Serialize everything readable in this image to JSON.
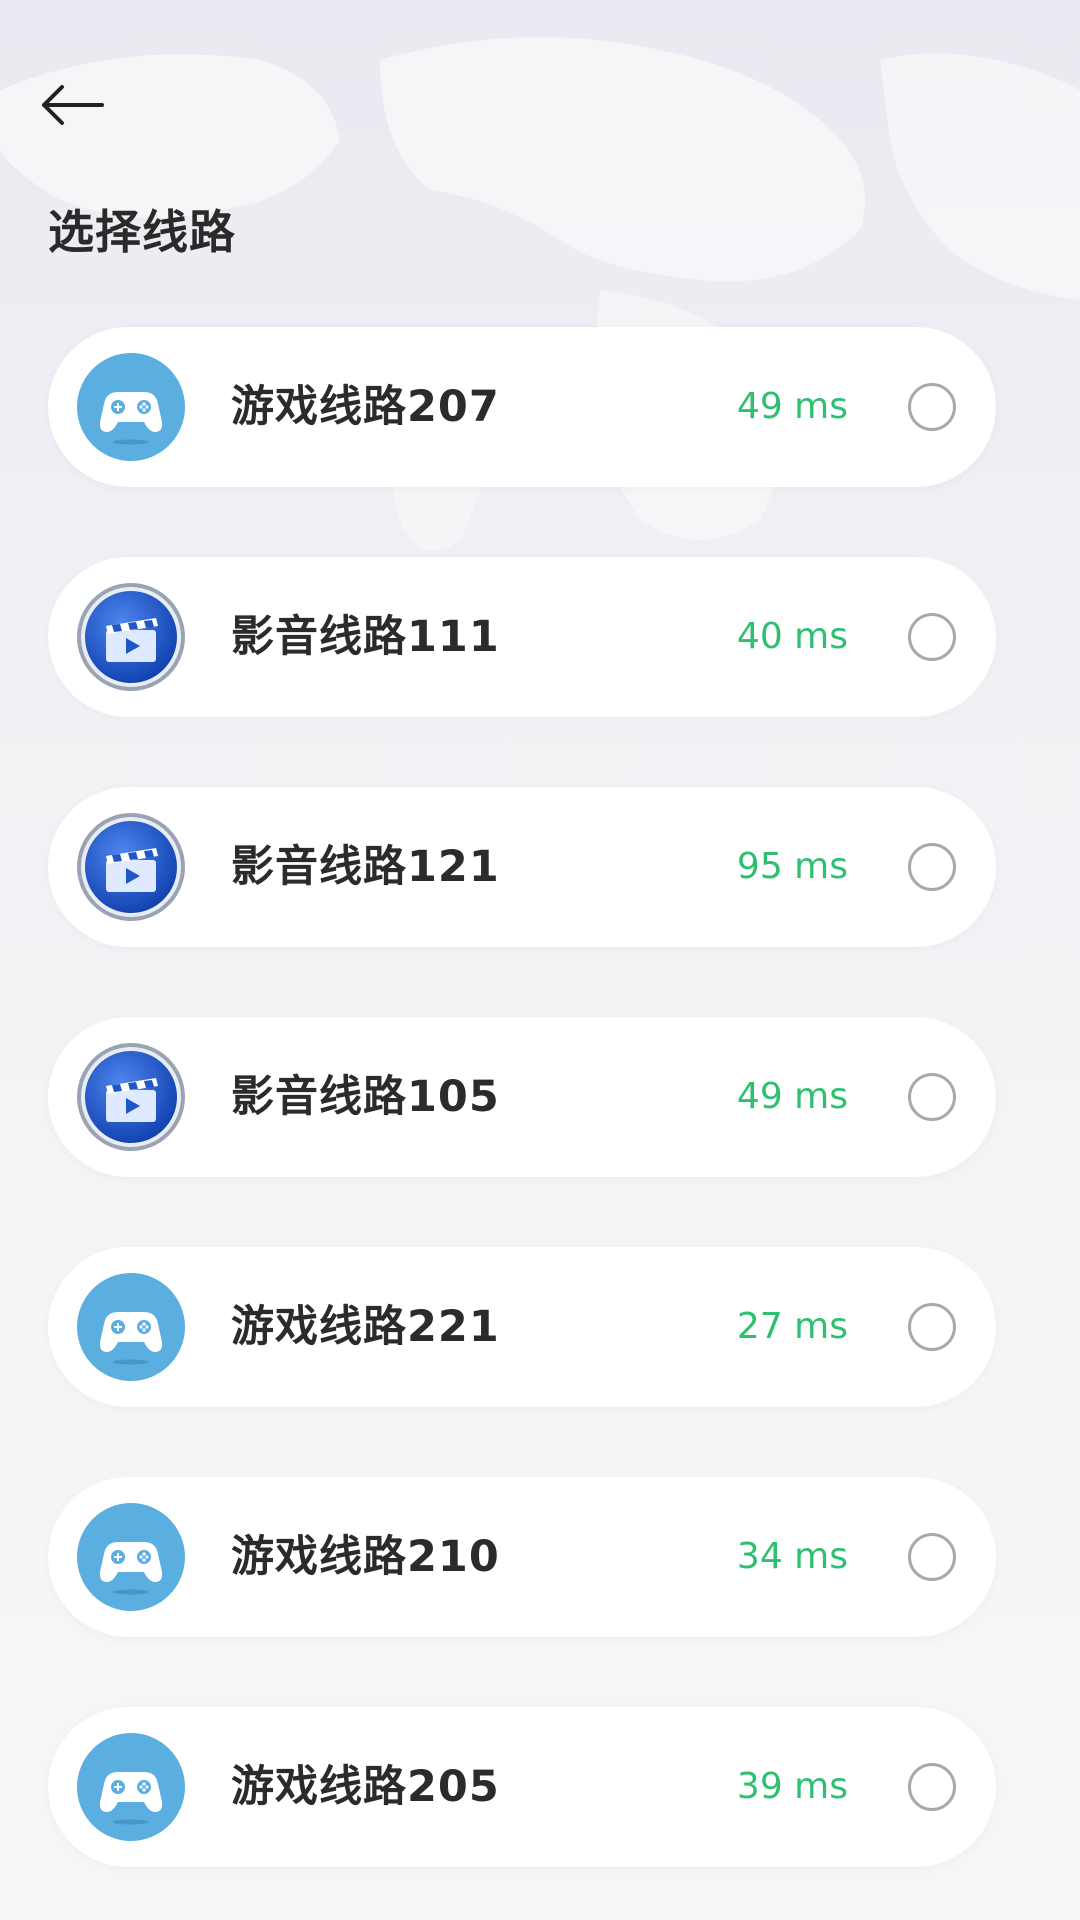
{
  "header": {
    "back_icon": "arrow-left-icon",
    "title": "选择线路"
  },
  "colors": {
    "latency_green": "#2fbf71",
    "game_icon_blue": "#5aaee0",
    "media_icon_blue": "#1f56c8"
  },
  "routes": [
    {
      "name": "游戏线路207",
      "latency": "49 ms",
      "icon": "gamepad-icon"
    },
    {
      "name": "影音线路111",
      "latency": "40 ms",
      "icon": "clapperboard-icon"
    },
    {
      "name": "影音线路121",
      "latency": "95 ms",
      "icon": "clapperboard-icon"
    },
    {
      "name": "影音线路105",
      "latency": "49 ms",
      "icon": "clapperboard-icon"
    },
    {
      "name": "游戏线路221",
      "latency": "27 ms",
      "icon": "gamepad-icon"
    },
    {
      "name": "游戏线路210",
      "latency": "34 ms",
      "icon": "gamepad-icon"
    },
    {
      "name": "游戏线路205",
      "latency": "39 ms",
      "icon": "gamepad-icon"
    }
  ]
}
